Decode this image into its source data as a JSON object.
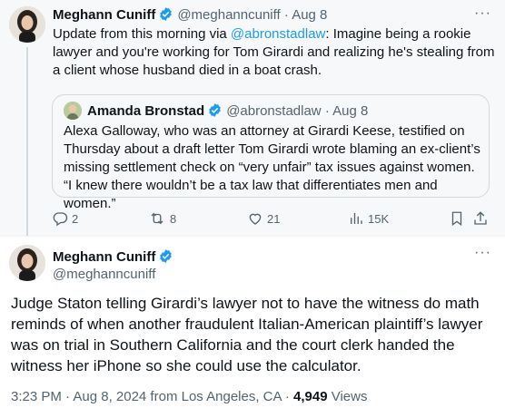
{
  "tweet1": {
    "name": "Meghann Cuniff",
    "handle": "@meghanncuniff",
    "time": "· Aug 8",
    "text_pre": "Update from this morning via ",
    "text_link": "@abronstadlaw",
    "text_post": ":  Imagine being a rookie lawyer and you're working for Tom Girardi and realizing he's stealing from a client whose husband died in a boat crash.",
    "quote": {
      "name": "Amanda Bronstad",
      "handle": "@abronstadlaw",
      "time": "· Aug 8",
      "text": "Alexa Galloway, who was an attorney at Girardi Keese, testified on Thursday about a draft letter Tom Girardi wrote blaming an ex-client’s missing settlement check on “very unfair” tax issues against women. “I knew there wouldn’t be a tax law that differentiates men and women.”"
    },
    "replies": "2",
    "reposts": "8",
    "likes": "21",
    "views": "15K"
  },
  "tweet2": {
    "name": "Meghann Cuniff",
    "handle": "@meghanncuniff",
    "text": "Judge Staton telling Girardi’s lawyer not to have the witness do math reminds of when another fraudulent Italian-American plaintiff’s lawyer was on trial in Southern California and the court clerk handed the witness her iPhone so she could use the calculator.",
    "timestamp": "3:23 PM · Aug 8, 2024 from Los Angeles, CA · ",
    "views_count": "4,949",
    "views_label": " Views"
  },
  "more_glyph": "···",
  "colors": {
    "accent": "#1d9bf0",
    "muted": "#536471",
    "text": "#0f1419",
    "border": "#cfd9de"
  },
  "icons": [
    "verified-badge-icon",
    "reply-icon",
    "repost-icon",
    "like-icon",
    "views-icon",
    "bookmark-icon",
    "share-icon",
    "more-icon"
  ]
}
